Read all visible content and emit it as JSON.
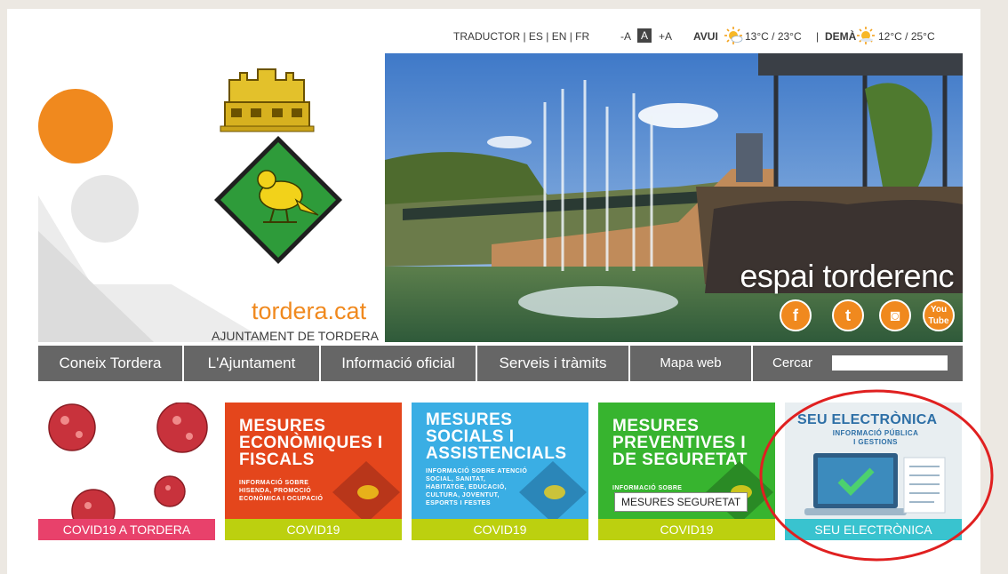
{
  "topbar": {
    "translator": "TRADUCTOR | ES | EN | FR",
    "font_smaller": "-A",
    "font_normal": "A",
    "font_larger": "+A",
    "today_label": "AVUI",
    "today_temp": "13°C / 23°C",
    "separator": "|",
    "tomorrow_label": "DEMÀ",
    "tomorrow_temp": "12°C / 25°C"
  },
  "header": {
    "site_name": "tordera.cat",
    "site_subtitle": "AJUNTAMENT DE TORDERA",
    "hero_text": "espai torderenc"
  },
  "social": {
    "facebook": "f",
    "twitter": "t",
    "instagram": "◙",
    "youtube": "You Tube"
  },
  "nav": {
    "items": [
      {
        "label": "Coneix Tordera"
      },
      {
        "label": "L'Ajuntament"
      },
      {
        "label": "Informació oficial"
      },
      {
        "label": "Serveis i tràmits"
      }
    ],
    "map": "Mapa web",
    "search_label": "Cercar"
  },
  "tiles": [
    {
      "title": "",
      "text": "",
      "caption": "COVID19 A TORDERA"
    },
    {
      "title": "MESURES ECONÒMIQUES I FISCALS",
      "text": "INFORMACIÓ SOBRE HISENDA, PROMOCIÓ ECONÒMICA I OCUPACIÓ",
      "caption": "COVID19"
    },
    {
      "title": "MESURES SOCIALS I ASSISTENCIALS",
      "text": "INFORMACIÓ SOBRE ATENCIÓ SOCIAL, SANITAT, HABITATGE, EDUCACIÓ, CULTURA, JOVENTUT, ESPORTS I FESTES",
      "caption": "COVID19"
    },
    {
      "title": "MESURES PREVENTIVES I DE SEGURETAT",
      "text": "INFORMACIÓ SOBRE",
      "caption": "COVID19"
    },
    {
      "title": "SEU ELECTRÒNICA",
      "text": "INFORMACIÓ PÚBLICA I GESTIONS",
      "caption": "SEU ELECTRÒNICA"
    }
  ],
  "tooltip": "MESURES SEGURETAT",
  "colors": {
    "orange": "#f0891e",
    "nav_gray": "#666666",
    "covid_pink": "#e8416b",
    "lime": "#bcd00f",
    "economic_red": "#e4461c",
    "social_blue": "#3aaee4",
    "preventive_green": "#37b42f",
    "seu_teal": "#39c3cf",
    "highlight_red": "#e02020"
  }
}
